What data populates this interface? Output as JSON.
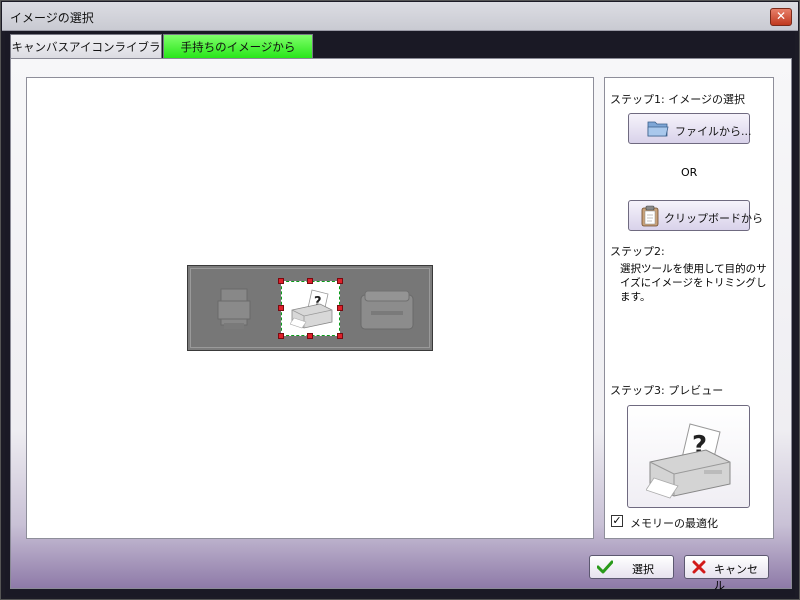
{
  "window": {
    "title": "イメージの選択",
    "close_glyph": "✕"
  },
  "tabs": [
    {
      "label": "キャンバスアイコンライブラリから",
      "active": false
    },
    {
      "label": "手持ちのイメージから",
      "active": true
    }
  ],
  "side": {
    "step1_label": "ステップ1: イメージの選択",
    "file_button": "ファイルから...",
    "or_text": "OR",
    "clipboard_button": "クリップボードから",
    "step2_label": "ステップ2:",
    "step2_description": "選択ツールを使用して目的のサイズにイメージをトリミングします。",
    "step3_label": "ステップ3: プレビュー",
    "optimize_label": "メモリーの最適化",
    "optimize_checked": true
  },
  "footer": {
    "select_button": "選択",
    "cancel_button": "キャンセル"
  },
  "icons": {
    "folder": "folder-icon",
    "clipboard": "clipboard-icon",
    "check": "checkmark-icon",
    "cancel": "x-icon",
    "printer": "printer-question-icon"
  },
  "colors": {
    "active_tab": "#28e61a",
    "selection_border": "#0a9a1a",
    "handle": "#e0202a"
  }
}
